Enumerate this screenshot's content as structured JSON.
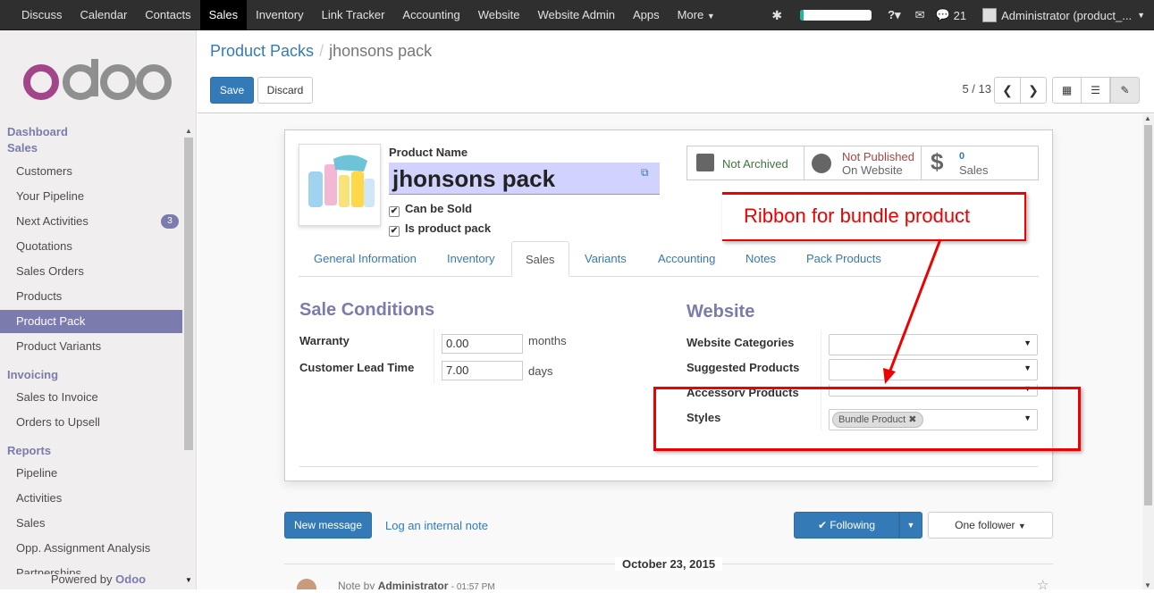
{
  "topbar": {
    "menu": [
      "Discuss",
      "Calendar",
      "Contacts",
      "Sales",
      "Inventory",
      "Link Tracker",
      "Accounting",
      "Website",
      "Website Admin",
      "Apps",
      "More"
    ],
    "active": "Sales",
    "messages_count": "21",
    "user": "Administrator (product_..."
  },
  "sidebar": {
    "sections": {
      "dashboard": "Dashboard",
      "sales": "Sales",
      "invoicing": "Invoicing",
      "reports": "Reports"
    },
    "sales_items": [
      "Customers",
      "Your Pipeline",
      "Next Activities",
      "Quotations",
      "Sales Orders",
      "Products",
      "Product Pack",
      "Product Variants"
    ],
    "next_activities_badge": "3",
    "invoicing_items": [
      "Sales to Invoice",
      "Orders to Upsell"
    ],
    "reports_items": [
      "Pipeline",
      "Activities",
      "Sales",
      "Opp. Assignment Analysis",
      "Partnerships"
    ],
    "powered_by": "Powered by",
    "powered_brand": "Odoo"
  },
  "control_panel": {
    "breadcrumb_parent": "Product Packs",
    "breadcrumb_current": "jhonsons pack",
    "save_label": "Save",
    "discard_label": "Discard",
    "pager": "5 / 13"
  },
  "form": {
    "product_name_label": "Product Name",
    "product_name": "jhonsons pack",
    "can_be_sold": "Can be Sold",
    "is_product_pack": "Is product pack",
    "stats": {
      "archived": "Not Archived",
      "published_line1": "Not Published",
      "published_line2": "On Website",
      "sales_count": "0",
      "sales_label": "Sales"
    },
    "tabs": [
      "General Information",
      "Inventory",
      "Sales",
      "Variants",
      "Accounting",
      "Notes",
      "Pack Products"
    ],
    "active_tab": "Sales",
    "sale_conditions": {
      "title": "Sale Conditions",
      "warranty_label": "Warranty",
      "warranty_value": "0.00",
      "warranty_unit": "months",
      "lead_time_label": "Customer Lead Time",
      "lead_time_value": "7.00",
      "lead_time_unit": "days"
    },
    "website": {
      "title": "Website",
      "categories_label": "Website Categories",
      "suggested_label": "Suggested Products",
      "accessory_label": "Accessory Products",
      "styles_label": "Styles",
      "style_tag": "Bundle Product"
    }
  },
  "annotation": {
    "text": "Ribbon for bundle product"
  },
  "chatter": {
    "new_message": "New message",
    "log_note": "Log an internal note",
    "following": "Following",
    "followers": "One follower",
    "date": "October 23, 2015",
    "note_prefix": "Note by",
    "note_author": "Administrator",
    "note_time": "- 01:57 PM"
  },
  "colors": {
    "brand": "#7c7bad",
    "primary": "#337ab7",
    "annotation": "#ee0000"
  }
}
